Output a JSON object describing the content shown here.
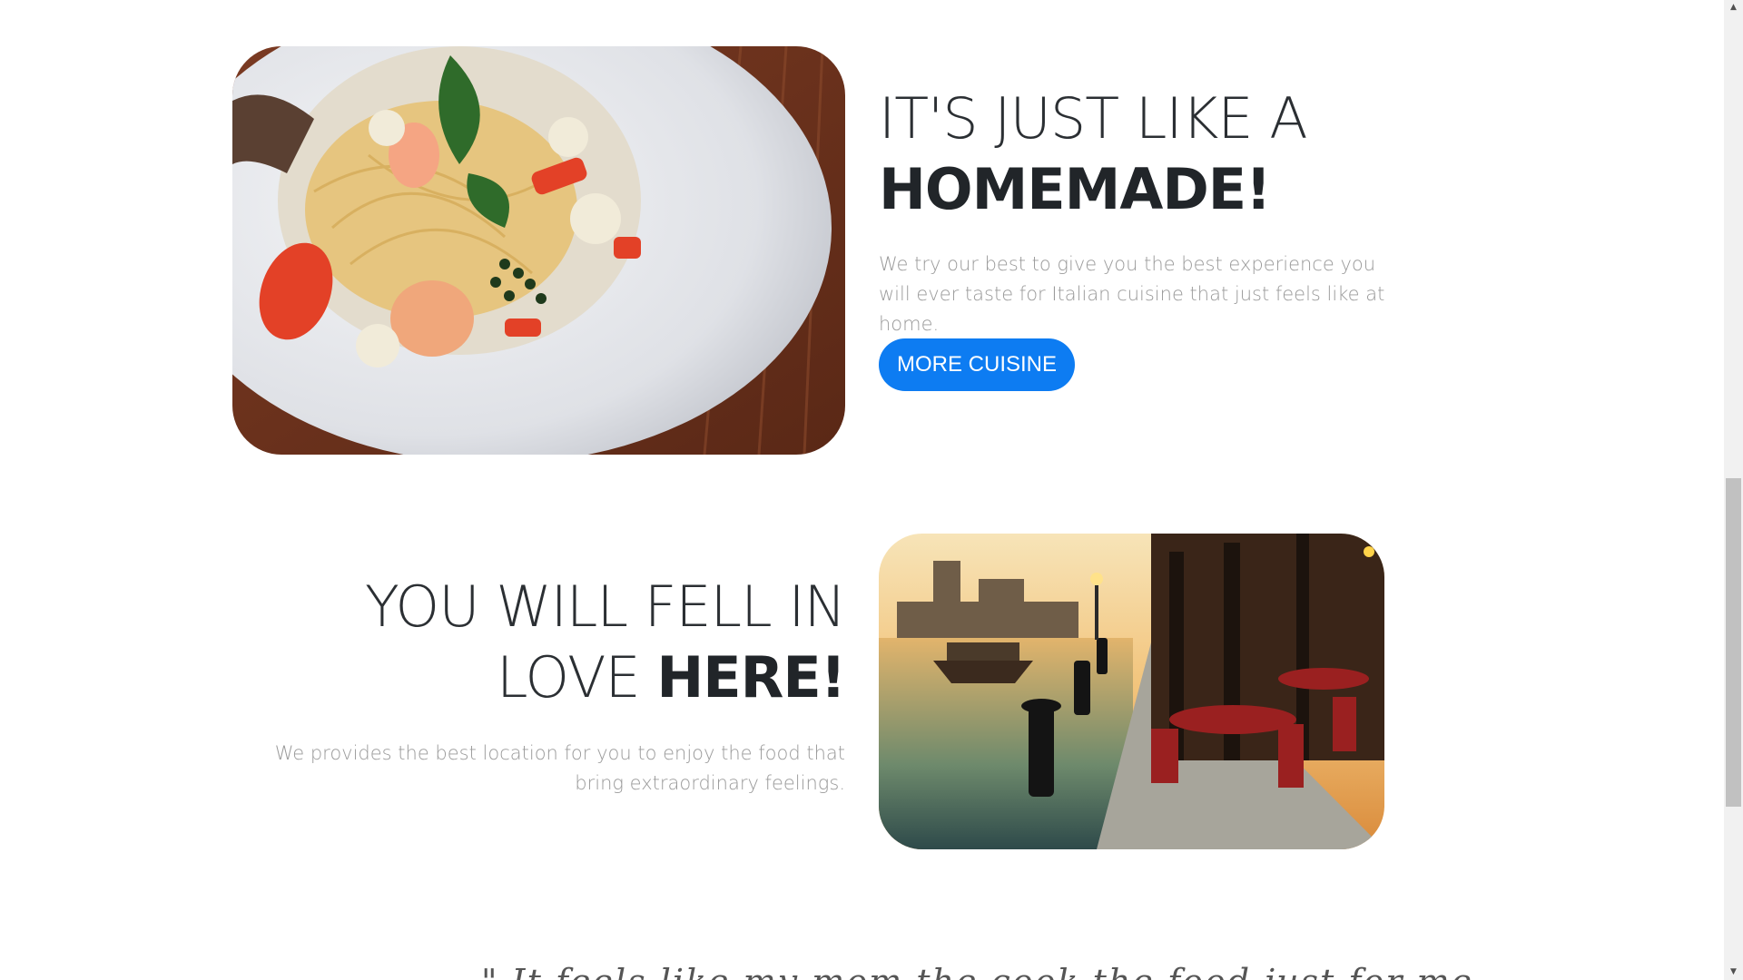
{
  "section_homemade": {
    "heading_light": "IT'S JUST LIKE A",
    "heading_bold": "HOMEMADE!",
    "description": "We try our best to give you the best experience you will ever taste for Italian cuisine that just feels like at home.",
    "button_label": "MORE CUISINE",
    "image_subject": "pasta-shrimp-plate-photo"
  },
  "section_location": {
    "heading_light": "YOU WILL FELL IN LOVE ",
    "heading_bold": "HERE!",
    "description": "We provides the best location for you to enjoy the food that bring extraordinary feelings.",
    "image_subject": "waterfront-terrace-photo"
  },
  "testimonial": {
    "quote_partial": "\" It feels like my mom the cook the food just for me"
  },
  "colors": {
    "accent": "#0d7cf2",
    "heading": "#212529",
    "body_text": "#9a9a9a",
    "background": "#ffffff"
  },
  "icons": {
    "scroll_up": "chevron-up-icon",
    "scroll_down": "chevron-down-icon"
  }
}
